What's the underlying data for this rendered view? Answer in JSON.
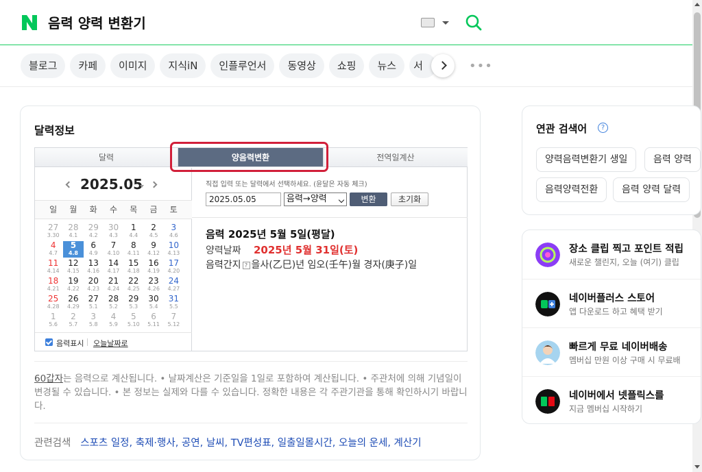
{
  "header": {
    "query": "음력 양력 변환기"
  },
  "tabs": [
    "블로그",
    "카페",
    "이미지",
    "지식iN",
    "인플루언서",
    "동영상",
    "쇼핑",
    "뉴스",
    "서"
  ],
  "card": {
    "title": "달력정보",
    "widget_tabs": [
      "달력",
      "양음력변환",
      "전역일계산"
    ],
    "calendar": {
      "title": "2025.05",
      "weekdays": [
        "일",
        "월",
        "화",
        "수",
        "목",
        "금",
        "토"
      ],
      "days": [
        {
          "s": "27",
          "l": "3.30",
          "dim": true
        },
        {
          "s": "28",
          "l": "4.1",
          "dim": true
        },
        {
          "s": "29",
          "l": "4.2",
          "dim": true
        },
        {
          "s": "30",
          "l": "4.3",
          "dim": true
        },
        {
          "s": "1",
          "l": "4.4"
        },
        {
          "s": "2",
          "l": "4.5"
        },
        {
          "s": "3",
          "l": "4.6"
        },
        {
          "s": "4",
          "l": "4.7"
        },
        {
          "s": "5",
          "l": "4.8",
          "sel": true
        },
        {
          "s": "6",
          "l": "4.9"
        },
        {
          "s": "7",
          "l": "4.10"
        },
        {
          "s": "8",
          "l": "4.11"
        },
        {
          "s": "9",
          "l": "4.12"
        },
        {
          "s": "10",
          "l": "4.13"
        },
        {
          "s": "11",
          "l": "4.14"
        },
        {
          "s": "12",
          "l": "4.15"
        },
        {
          "s": "13",
          "l": "4.16"
        },
        {
          "s": "14",
          "l": "4.17"
        },
        {
          "s": "15",
          "l": "4.18"
        },
        {
          "s": "16",
          "l": "4.19"
        },
        {
          "s": "17",
          "l": "4.20"
        },
        {
          "s": "18",
          "l": "4.21"
        },
        {
          "s": "19",
          "l": "4.22"
        },
        {
          "s": "20",
          "l": "4.23"
        },
        {
          "s": "21",
          "l": "4.24"
        },
        {
          "s": "22",
          "l": "4.25"
        },
        {
          "s": "23",
          "l": "4.26"
        },
        {
          "s": "24",
          "l": "4.27"
        },
        {
          "s": "25",
          "l": "4.28"
        },
        {
          "s": "26",
          "l": "4.29"
        },
        {
          "s": "27",
          "l": "5.1"
        },
        {
          "s": "28",
          "l": "5.2"
        },
        {
          "s": "29",
          "l": "5.3"
        },
        {
          "s": "30",
          "l": "5.4"
        },
        {
          "s": "31",
          "l": "5.5"
        },
        {
          "s": "1",
          "l": "5.6",
          "dim": true
        },
        {
          "s": "2",
          "l": "5.7",
          "dim": true
        },
        {
          "s": "3",
          "l": "5.8",
          "dim": true
        },
        {
          "s": "4",
          "l": "5.9",
          "dim": true
        },
        {
          "s": "5",
          "l": "5.10",
          "dim": true
        },
        {
          "s": "6",
          "l": "5.11",
          "dim": true
        },
        {
          "s": "7",
          "l": "5.12",
          "dim": true
        }
      ],
      "footer_checkbox": "음력표시",
      "footer_today": "오늘날짜로"
    },
    "converter": {
      "hint": "직접 입력 또는 달력에서 선택하세요. (윤달은 자동 체크)",
      "input_value": "2025.05.05",
      "select_value": "음력→양력",
      "convert_button": "변환",
      "reset_button": "초기화",
      "result_title": "음력 2025년 5월 5일(평달)",
      "result_label": "양력날짜",
      "result_value": "2025년 5월 31일(토)",
      "ganji_label": "음력간지",
      "ganji_help": "?",
      "ganji_value": "을사(乙巳)년 임오(壬午)월 경자(庚子)일"
    },
    "note": {
      "term": "60갑자",
      "text": "는 음력으로 계산됩니다. • 날짜계산은 기준일을 1일로 포함하여 계산됩니다. • 주관처에 의해 기념일이 변경될 수 있습니다. • 본 정보는 실제와 다를 수 있습니다. 정확한 내용은 각 주관기관을 통해 확인하시기 바랍니다."
    },
    "related": {
      "label": "관련검색",
      "links": [
        "스포츠 일정",
        "축제·행사",
        "공연",
        "날씨",
        "TV편성표",
        "일출일몰시간",
        "오늘의 운세",
        "계산기"
      ]
    }
  },
  "related_searches": {
    "title": "연관 검색어",
    "help": "?",
    "keywords": [
      "양력음력변환기 생일",
      "음력 양력",
      "음력양력전환",
      "음력 양력 달력"
    ]
  },
  "promos": [
    {
      "icon": "clip-icon",
      "title": "장소 클립 찍고 포인트 적립",
      "sub": "새로운 챌린지, 오늘 (여기) 클립",
      "color": "#8b3df5"
    },
    {
      "icon": "naverplus-icon",
      "title": "네이버플러스 스토어",
      "sub": "앱 다운로드 하고 혜택 받기",
      "color": "#111111"
    },
    {
      "icon": "delivery-icon",
      "title": "빠르게 무료 네이버배송",
      "sub": "멤버십 만원 이상 구매 시 무료배",
      "color": "#a6d4ef"
    },
    {
      "icon": "netflix-icon",
      "title": "네이버에서 넷플릭스를",
      "sub": "지금 멤버십 시작하기",
      "color": "#111111"
    }
  ],
  "colors": {
    "brand": "#03c75a",
    "tab_active": "#5c6b82",
    "highlight": "#d11f39",
    "result_red": "#e0302f",
    "link": "#1c4bb5"
  }
}
